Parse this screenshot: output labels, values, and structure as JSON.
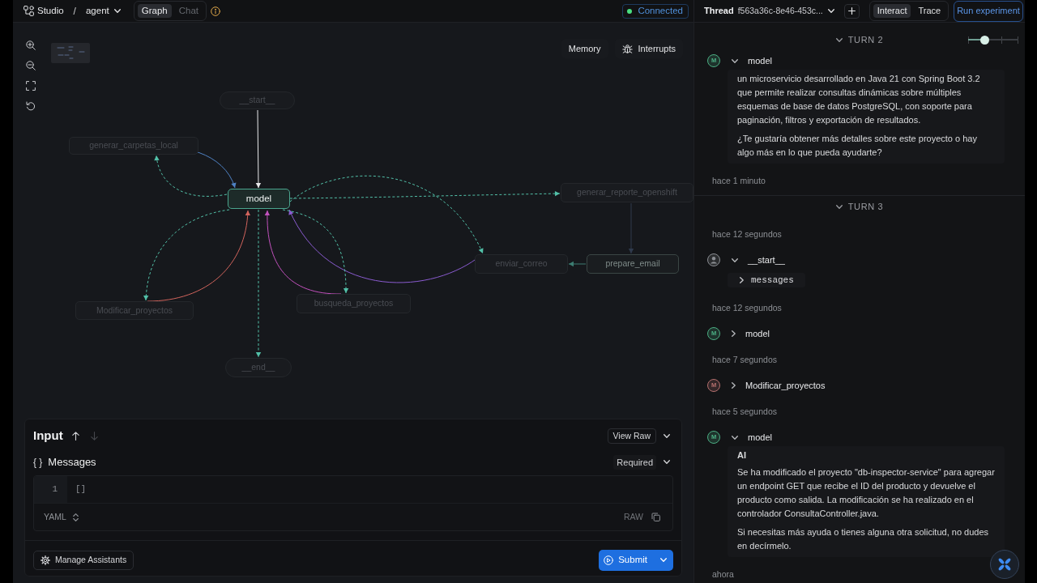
{
  "top_bar": {
    "app_name": "Studio",
    "separator": "/",
    "graph_select": "agent",
    "view_tabs": [
      {
        "label": "Graph",
        "selected": true
      },
      {
        "label": "Chat",
        "selected": false
      }
    ],
    "connection": {
      "label": "Connected",
      "connected": true
    },
    "thread": {
      "label": "Thread",
      "id": "f563a36c-8e46-453c..."
    },
    "mode_tabs": [
      {
        "label": "Interact",
        "selected": true
      },
      {
        "label": "Trace",
        "selected": false
      }
    ],
    "run_button": "Run experiment"
  },
  "graph": {
    "memory_button": "Memory",
    "interrupts_button": "Interrupts",
    "nodes": [
      {
        "label": "__start__",
        "kind": "terminal",
        "active": false,
        "dimmed": true
      },
      {
        "label": "generar_carpetas_local",
        "kind": "step",
        "active": false,
        "dimmed": true
      },
      {
        "label": "model",
        "kind": "step",
        "active": true,
        "dimmed": false
      },
      {
        "label": "generar_reporte_openshift",
        "kind": "step",
        "active": false,
        "dimmed": true
      },
      {
        "label": "enviar_correo",
        "kind": "step",
        "active": false,
        "dimmed": true
      },
      {
        "label": "prepare_email",
        "kind": "step",
        "active": false,
        "dimmed": false
      },
      {
        "label": "Modificar_proyectos",
        "kind": "step",
        "active": false,
        "dimmed": true
      },
      {
        "label": "busqueda_proyectos",
        "kind": "step",
        "active": false,
        "dimmed": true
      },
      {
        "label": "__end__",
        "kind": "terminal",
        "active": false,
        "dimmed": true
      }
    ]
  },
  "input_panel": {
    "title": "Input",
    "history_buttons": [
      {
        "kind": "up",
        "disabled": false
      },
      {
        "kind": "down",
        "disabled": true
      }
    ],
    "view_raw_button": "View Raw",
    "field": {
      "type_symbol": "{ }",
      "label": "Messages",
      "requirement": "Required"
    },
    "editor": {
      "lines": [
        {
          "number": "1",
          "code": "[]"
        }
      ],
      "format": "YAML",
      "raw_label": "RAW"
    },
    "manage_button": "Manage Assistants",
    "submit_button": "Submit"
  },
  "thread_panel": {
    "turn_slider": {
      "level": 0.33
    },
    "turns": [
      {
        "label": "TURN 2",
        "expanded": true,
        "entries": [
          {
            "kind": "step",
            "name": "model",
            "avatar": {
              "kind": "letter",
              "text": "M",
              "color": "#4caf84"
            },
            "expanded": true,
            "message": {
              "paragraphs": [
                "un microservicio desarrollado en Java 21 con Spring Boot 3.2 que permite realizar consultas dinámicas sobre múltiples esquemas de base de datos PostgreSQL, con soporte para paginación, filtros y exportación de resultados.",
                "¿Te gustaría obtener más detalles sobre este proyecto o hay algo más en lo que pueda ayudarte?"
              ]
            }
          },
          {
            "kind": "time",
            "text": "hace 1 minuto"
          }
        ]
      },
      {
        "label": "TURN 3",
        "expanded": true,
        "entries": [
          {
            "kind": "time",
            "text": "hace 12 segundos"
          },
          {
            "kind": "step",
            "name": "__start__",
            "avatar": {
              "kind": "person",
              "color": "#8c8f94"
            },
            "expanded": true,
            "fields": [
              {
                "label": "messages",
                "expanded": false
              }
            ]
          },
          {
            "kind": "time",
            "text": "hace 12 segundos"
          },
          {
            "kind": "step",
            "name": "model",
            "avatar": {
              "kind": "letter",
              "text": "M",
              "color": "#4caf84"
            },
            "expanded": false
          },
          {
            "kind": "time",
            "text": "hace 7 segundos"
          },
          {
            "kind": "step",
            "name": "Modificar_proyectos",
            "avatar": {
              "kind": "letter",
              "text": "M",
              "color": "#b5706e"
            },
            "expanded": false
          },
          {
            "kind": "time",
            "text": "hace 5 segundos"
          },
          {
            "kind": "step",
            "name": "model",
            "avatar": {
              "kind": "letter",
              "text": "M",
              "color": "#4caf84"
            },
            "expanded": true,
            "message": {
              "role": "AI",
              "paragraphs": [
                "Se ha modificado el proyecto \"db-inspector-service\" para agregar un endpoint GET que recibe el ID del producto y devuelve el producto como salida. La modificación se ha realizado en el controlador ConsultaController.java.",
                "Si necesitas más ayuda o tienes alguna otra solicitud, no dudes en decírmelo."
              ]
            }
          },
          {
            "kind": "time",
            "text": "ahora"
          }
        ]
      }
    ]
  }
}
